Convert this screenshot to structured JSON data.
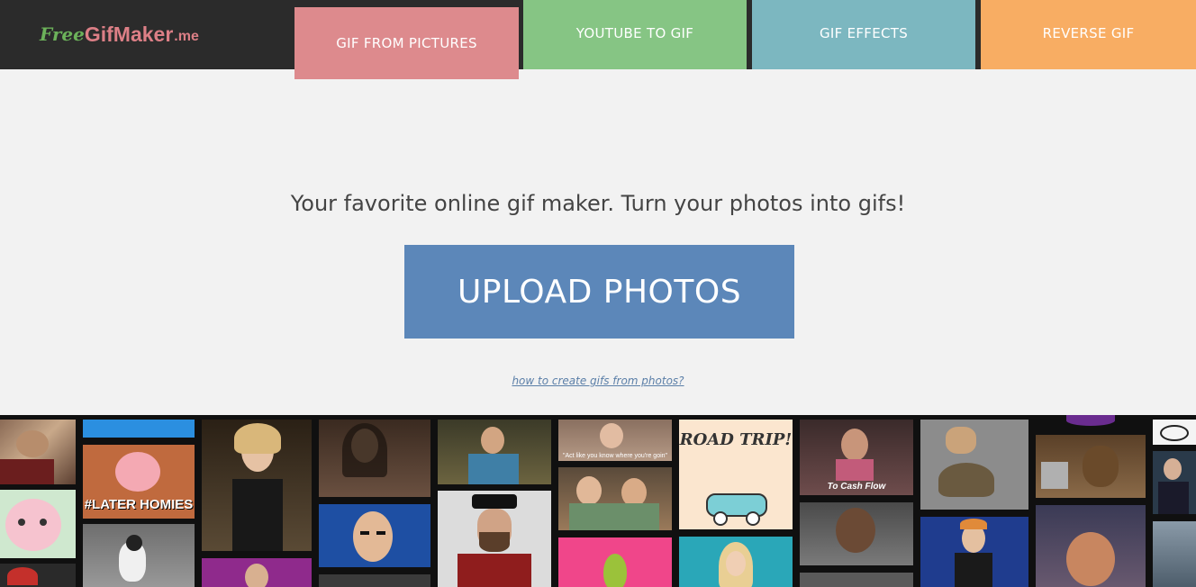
{
  "header": {
    "logo": {
      "part1": "Free",
      "part2": "GifMaker",
      "part3": ".me"
    },
    "nav": [
      {
        "label": "GIF FROM PICTURES",
        "color": "#dd8a8d"
      },
      {
        "label": "YOUTUBE TO GIF",
        "color": "#86c584"
      },
      {
        "label": "GIF EFFECTS",
        "color": "#7cb7c0"
      },
      {
        "label": "REVERSE GIF",
        "color": "#f8ad63"
      }
    ]
  },
  "main": {
    "tagline": "Your favorite online gif maker. Turn your photos into gifs!",
    "upload_label": "UPLOAD PHOTOS",
    "help_link": "how to create gifs from photos?"
  },
  "gallery": {
    "captions": {
      "later_homies": "#LATER HOMIES",
      "road_trip": "ROAD TRIP!",
      "cash_flow": "To Cash Flow",
      "act_like": "\"Act like you know where you're goin\""
    }
  }
}
